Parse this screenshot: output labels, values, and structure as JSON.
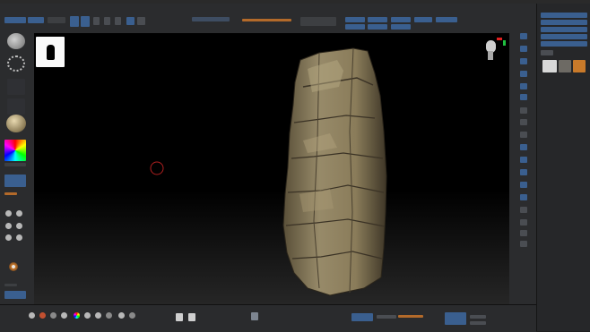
{
  "menubar": {
    "items": [
      "",
      "",
      "",
      "",
      "",
      "",
      "",
      "",
      "",
      "",
      "",
      "",
      "",
      "",
      ""
    ]
  },
  "toolbar": {
    "btn_a": "",
    "btn_b": "",
    "btn_c": "",
    "mode_buttons": [
      "",
      "",
      "",
      "",
      ""
    ],
    "sliders": [
      "",
      "",
      ""
    ]
  },
  "left_shelf": {
    "label_a": "",
    "label_b": ""
  },
  "tray": {
    "items": [
      "",
      "",
      "",
      "",
      "",
      "",
      "",
      "",
      "",
      "",
      "",
      "",
      "",
      "",
      "",
      "",
      "",
      "",
      "",
      "",
      "",
      "",
      "",
      "",
      "",
      "",
      "",
      "",
      ""
    ]
  },
  "bottom": {
    "label_a": "",
    "label_b": ""
  },
  "colors": {
    "accent": "#3a5f8f",
    "rock": "#8c7f60",
    "brush_cursor": "#b02020",
    "axis_red": "#e02020",
    "axis_green": "#20c040"
  },
  "icons": [
    "head-icon",
    "rock-icon",
    "brush-icon",
    "color-picker-icon",
    "material-icon",
    "alpha-icon"
  ]
}
